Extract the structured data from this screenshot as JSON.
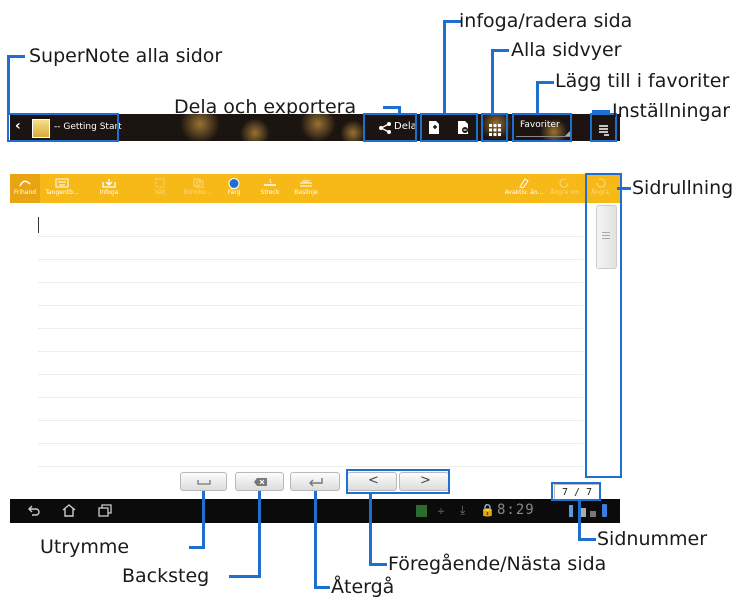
{
  "callouts": {
    "supernote": "SuperNote alla sidor",
    "infoga_radera": "infoga/radera sida",
    "alla_sidvyer": "Alla sidvyer",
    "favoriter": "Lägg till i favoriter",
    "dela_exportera": "Dela och exportera",
    "installningar": "Inställningar",
    "sidrullning": "Sidrullning",
    "utrymme": "Utrymme",
    "backsteg": "Backsteg",
    "atergaa": "Återgå",
    "foregaende_nasta": "Föregående/Nästa sida",
    "sidnummer": "Sidnummer"
  },
  "topbar": {
    "notebook_title": "-- Getting Start",
    "share_label": "Dela",
    "favorites_label": "Favoriter"
  },
  "toolbar": {
    "items": [
      {
        "label": "Frihand"
      },
      {
        "label": "Tangentb..."
      },
      {
        "label": "Infoga"
      },
      {
        "label": "Välj"
      },
      {
        "label": "Blinkbo..."
      },
      {
        "label": "Färg"
      },
      {
        "label": "Streck"
      },
      {
        "label": "Baslinje"
      }
    ],
    "right_items": [
      {
        "label": "Avaktiv. än..."
      },
      {
        "label": "Ångra om"
      },
      {
        "label": "Ångra"
      }
    ]
  },
  "page_indicator": "7 / 7",
  "statusbar": {
    "clock": "8:29"
  },
  "colors": {
    "accent": "#1e6fd0",
    "toolbar": "#f6b918",
    "topbar": "#1b1410"
  }
}
